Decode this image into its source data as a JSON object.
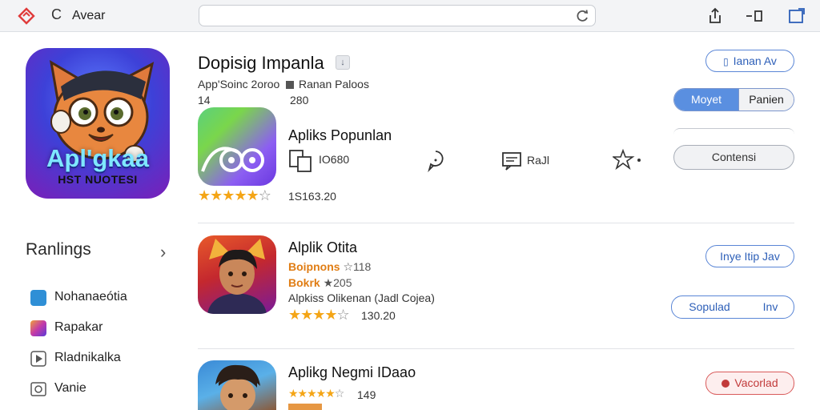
{
  "window": {
    "title": "Avear"
  },
  "app": {
    "title": "Dopisig Impanla",
    "publisher": "App'Soinc 2oroo",
    "publisher_tag": "Ranan Paloos",
    "meta_left": "14",
    "meta_right": "280"
  },
  "hero": {
    "title": "Apl'gkaa",
    "subtitle": "HST NUOTESI"
  },
  "sidebar": {
    "heading": "Ranlings",
    "items": [
      {
        "label": "Nohanaeótia"
      },
      {
        "label": "Rapakar"
      },
      {
        "label": "Rladnikalka"
      },
      {
        "label": "Vanie"
      }
    ]
  },
  "buttons": {
    "top_right": "Ianan Av",
    "segment_a": "Moyet",
    "segment_b": "Panien",
    "contains": "Contensi"
  },
  "featured": {
    "title": "Apliks Popunlan",
    "copy_count": "IO680",
    "rail_label": "RaJl",
    "rating_count": "1S163.20",
    "rating": 4.5
  },
  "list": [
    {
      "title": "Alplik Otita",
      "line1": "Boipnons",
      "line1_count": "118",
      "line2": "Bokrk",
      "line2_count": "205",
      "desc": "Alpkiss Olikenan (Jadl Cojea)",
      "rating_count": "130.20",
      "rating": 4,
      "btn1": "Inye Itip Jav",
      "btn2a": "Sopulad",
      "btn2b": "Inv"
    },
    {
      "title": "Aplikg Negmi IDaao",
      "rating_count": "149",
      "rating": 4.5,
      "btn1": "Vacorlad"
    }
  ],
  "colors": {
    "accent": "#5a8fe0",
    "star": "#f4a516",
    "danger": "#d95a5a"
  }
}
